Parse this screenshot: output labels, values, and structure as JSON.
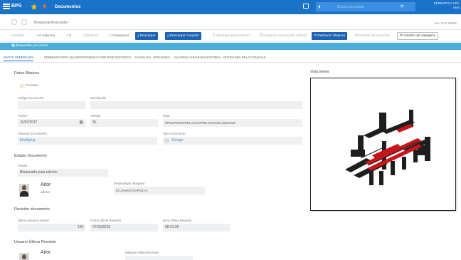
{
  "app": {
    "logo_text": "BPS",
    "window_title": "Documentos",
    "search_placeholder": "Busqueda rápida",
    "user_line1": "BERMATICA LTD.",
    "user_line2": "Mon"
  },
  "breadcrumb": {
    "text": "Búsqueda Avanzada /",
    "version": "Ver. 10.0.20065"
  },
  "toolbar": {
    "save": "Guardar",
    "attachments": "0 adjuntos",
    "comments": "0",
    "delete": "Eliminar",
    "categories": "Categorías",
    "download": "Descargar",
    "download_set": "Descargar conjunto",
    "block_edit": "Bloquear para edición",
    "register_external": "Registrar documento editado",
    "undo_block": "Deshacer bloqueo",
    "state_change": "Cambio de situación",
    "category_change": "Cambio de categoría"
  },
  "lock_banner": "Bloqueado por admin",
  "tabs": [
    "DATOS GENERALES",
    "PERMISOS POR USUARIO",
    "PERMISOS POR ROL",
    "CONTENIDO",
    "USADA EN",
    "OPINIONES",
    "VALORES VARIABLES",
    "HISTORIAL",
    "ENTIDADES RELACIONADAS"
  ],
  "basic": {
    "title": "Datos Básicos",
    "favorite": "Favorito",
    "code_label": "Código Documento",
    "code_value": "",
    "description_label": "Descripción",
    "description_value": "",
    "date_label": "Fecha *",
    "date_value": "11/07/2017",
    "version_label": "Versión",
    "version_value": "AL",
    "path_label": "Ruta",
    "path_value": "PROJPR01\\PR01-MAC\\PR01-MAC002.SLDASM",
    "situation_label": "Situación Documento",
    "situation_value": "Modifying",
    "type_label": "Tipo Documento",
    "type_value": "Design"
  },
  "state": {
    "title": "Estado documento",
    "status_label": "Estado",
    "status_value": "Bloqueado para edición",
    "user_name": "Aitor",
    "user_role": "admin",
    "machine_label": "Desprotegido Máquina",
    "machine_value": "ECJAMAZ-GAPD4AA"
  },
  "revision": {
    "title": "Revisión documento",
    "last_number_label": "Último número revisión",
    "last_number_value": "128",
    "last_date_label": "Fecha Última Revisión",
    "last_date_value": "07/03/2018",
    "last_time_label": "Hora Última Revisión",
    "last_time_value": "08:41:25"
  },
  "last_user": {
    "title": "Usuario Última Revisión",
    "user_name": "Aitor",
    "machine_label": "Máquina Última Revisión"
  },
  "preview": {
    "title": "Vista previa"
  }
}
